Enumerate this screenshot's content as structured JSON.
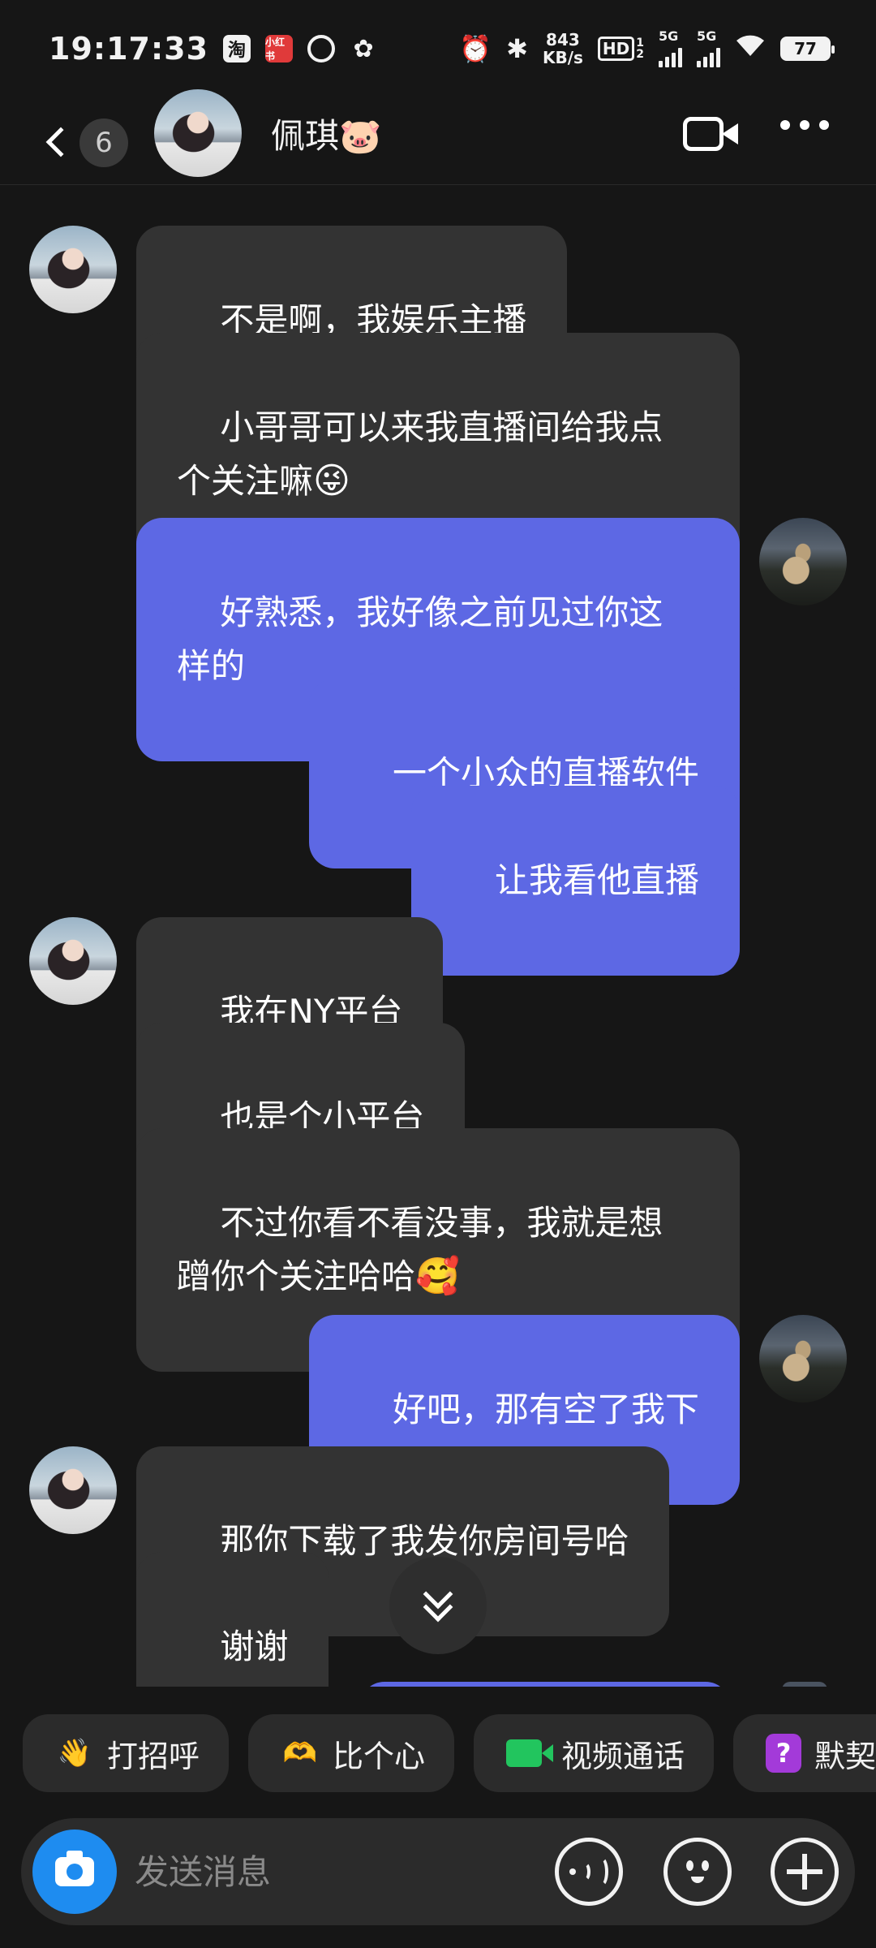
{
  "status_bar": {
    "time": "19:17:33",
    "app_icons": [
      "淘",
      "小红书"
    ],
    "speed_value": "843",
    "speed_unit": "KB/s",
    "hd_label": "HD",
    "hd_sub": "1",
    "hd_sub2": "2",
    "net1": "5G",
    "net2": "5G",
    "battery": "77"
  },
  "header": {
    "back_badge": "6",
    "contact_name": "佩琪🐷"
  },
  "messages": [
    {
      "side": "in",
      "text": "不是啊，我娱乐主播"
    },
    {
      "side": "in",
      "text": "小哥哥可以来我直播间给我点\n个关注嘛",
      "emoji": "😜"
    },
    {
      "side": "out",
      "text": "好熟悉，我好像之前见过你这\n样的"
    },
    {
      "side": "out",
      "text": "一个小众的直播软件"
    },
    {
      "side": "out",
      "text": "让我看他直播"
    },
    {
      "side": "in",
      "text": "我在NY平台"
    },
    {
      "side": "in",
      "text": "也是个小平台"
    },
    {
      "side": "in",
      "text": "不过你看不看没事，我就是想\n蹭你个关注哈哈",
      "emoji": "🥰"
    },
    {
      "side": "out",
      "text": "好吧，那有空了我下"
    },
    {
      "side": "in",
      "text": "那你下载了我发你房间号哈"
    },
    {
      "side": "in",
      "text": "谢谢"
    }
  ],
  "quick_actions": [
    {
      "label": "打招呼",
      "icon": "wave-sticker-icon",
      "glyph": "👋"
    },
    {
      "label": "比个心",
      "icon": "heart-sticker-icon",
      "glyph": "🫶"
    },
    {
      "label": "视频通话",
      "icon": "video-call-icon"
    },
    {
      "label": "默契",
      "icon": "question-icon",
      "glyph": "?"
    }
  ],
  "input": {
    "placeholder": "发送消息"
  },
  "colors": {
    "background": "#161616",
    "incoming_bubble": "#333333",
    "outgoing_bubble": "#5d68e4",
    "camera_button": "#1e8cf0"
  }
}
